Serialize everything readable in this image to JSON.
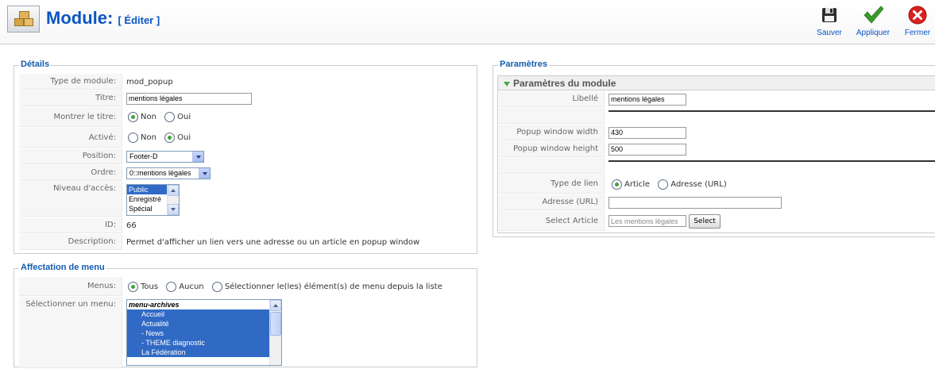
{
  "header": {
    "title": "Module:",
    "subtitle": "[ Éditer ]",
    "buttons": {
      "save": "Sauver",
      "apply": "Appliquer",
      "close": "Fermer"
    }
  },
  "details": {
    "legend": "Détails",
    "labels": {
      "type": "Type de module:",
      "title": "Titre:",
      "show_title": "Montrer le titre:",
      "enabled": "Activé:",
      "position": "Position:",
      "order": "Ordre:",
      "access": "Niveau d'accès:",
      "id": "ID:",
      "description": "Description:"
    },
    "type_value": "mod_popup",
    "title_value": "mentions légales",
    "show_title": {
      "options": [
        "Non",
        "Oui"
      ],
      "selected": "Non"
    },
    "enabled": {
      "options": [
        "Non",
        "Oui"
      ],
      "selected": "Oui"
    },
    "position_value": "Footer-D",
    "order_value": "0::mentions légales",
    "access_options": [
      "Public",
      "Enregistré",
      "Spécial"
    ],
    "access_selected": "Public",
    "id_value": "66",
    "description_value": "Permet d'afficher un lien vers une adresse ou un article en popup window"
  },
  "menu_assignment": {
    "legend": "Affectation de menu",
    "menus_label": "Menus:",
    "menus_options": [
      "Tous",
      "Aucun",
      "Sélectionner le(les) élément(s) de menu depuis la liste"
    ],
    "menus_selected": "Tous",
    "select_menu_label": "Sélectionner un menu:",
    "menu_list": [
      {
        "label": "menu-archives",
        "group": true
      },
      {
        "label": "Accueil"
      },
      {
        "label": "Actualité"
      },
      {
        "label": " - News"
      },
      {
        "label": " - THEME diagnostic"
      },
      {
        "label": "La Fédération"
      }
    ]
  },
  "params": {
    "legend": "Paramètres",
    "panel_title": "Paramètres du module",
    "labels": {
      "label": "Libellé",
      "popup_width": "Popup window width",
      "popup_height": "Popup window height",
      "link_type": "Type de lien",
      "url": "Adresse (URL)",
      "select_article": "Select Article"
    },
    "label_value": "mentions légales",
    "popup_width_value": "430",
    "popup_height_value": "500",
    "link_type": {
      "options": [
        "Article",
        "Adresse (URL)"
      ],
      "selected": "Article"
    },
    "url_value": "",
    "article_placeholder": "Les mentions légales",
    "select_button": "Select"
  },
  "colors": {
    "accent": "#0b55c4",
    "legend": "#135cae",
    "selection": "#316ac5",
    "radio_dot": "#3fa33a"
  }
}
